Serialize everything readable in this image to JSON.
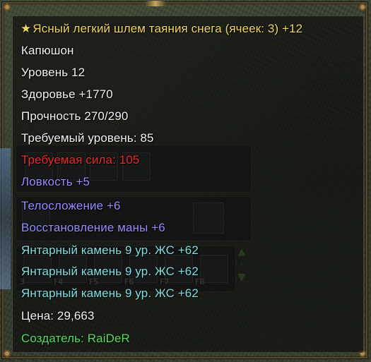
{
  "item": {
    "title_icon": "star-icon",
    "title": "Ясный легкий шлем таяния снега (ячеек: 3) +12",
    "type": "Капюшон",
    "level": "Уровень 12",
    "health": "Здоровье +1770",
    "durability": "Прочность 270/290",
    "required_level": "Требуемый уровень: 85",
    "required_strength": "Требуемая сила: 105",
    "agility": "Ловкость +5",
    "constitution": "Телосложение +6",
    "mana_regen": "Восстановление маны +6",
    "gems": [
      "Янтарный камень 9 ур. ЖС +62",
      "Янтарный камень 9 ур. ЖС +62",
      "Янтарный камень 9 ур. ЖС +62"
    ],
    "price": "Цена: 29,663",
    "creator": "Создатель: RaiDeR"
  },
  "hotbar": {
    "keys": [
      "3",
      "F4",
      "F5",
      "F6",
      "F7",
      "F8"
    ]
  },
  "colors": {
    "title": "#f2d85e",
    "normal": "#f3f3f3",
    "unmet_requirement": "#ee2a2a",
    "bonus_stat": "#9a8cff",
    "gem": "#7fe0e0",
    "creator": "#55e060"
  }
}
